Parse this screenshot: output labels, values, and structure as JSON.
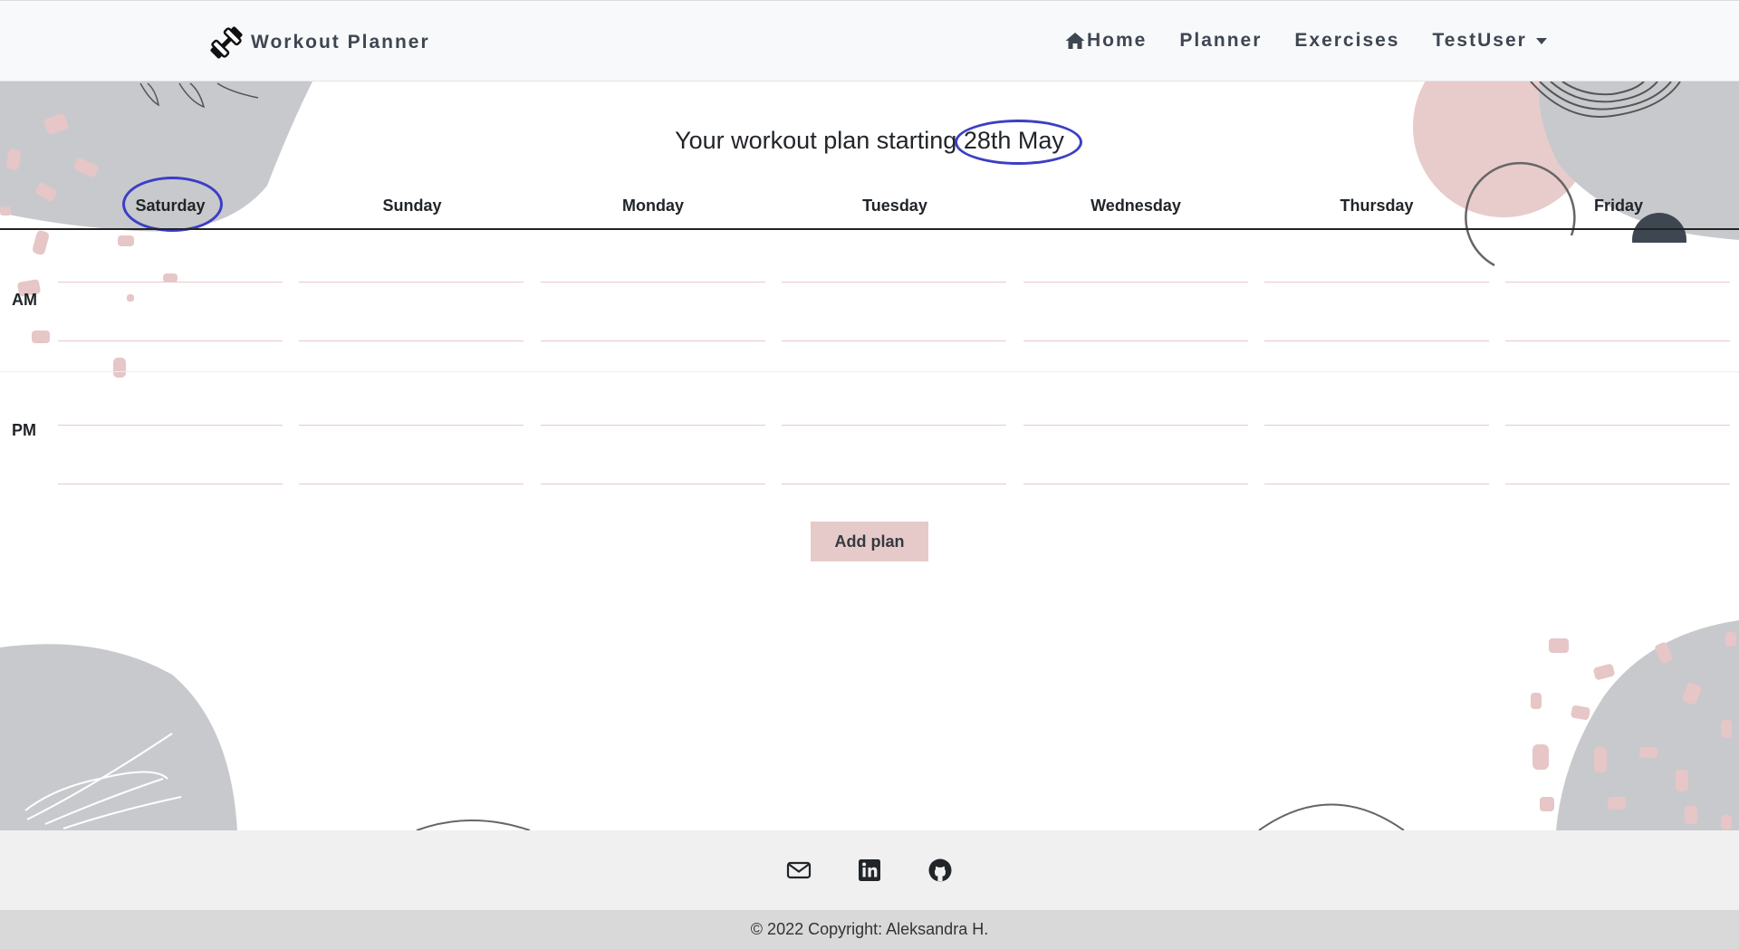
{
  "navbar": {
    "brand": "Workout Planner",
    "links": [
      {
        "label": "Home",
        "icon": "home-icon"
      },
      {
        "label": "Planner"
      },
      {
        "label": "Exercises"
      },
      {
        "label": "TestUser",
        "dropdown": true
      }
    ]
  },
  "main": {
    "title_prefix": "Your workout plan starting",
    "start_date": "28th May",
    "days": [
      "Saturday",
      "Sunday",
      "Monday",
      "Tuesday",
      "Wednesday",
      "Thursday",
      "Friday"
    ],
    "periods": [
      "AM",
      "PM"
    ],
    "add_button": "Add plan"
  },
  "footer": {
    "icons": [
      "mail-icon",
      "linkedin-icon",
      "github-icon"
    ],
    "copyright": "© 2022 Copyright: Aleksandra H."
  },
  "colors": {
    "nav_text": "#3e4651",
    "highlight_oval": "#3b3fc4",
    "button_bg": "#e6caca",
    "slot_underline": "#e7c9c9",
    "blob_gray": "#c8c9cd",
    "blob_pink": "#e8cccb"
  }
}
